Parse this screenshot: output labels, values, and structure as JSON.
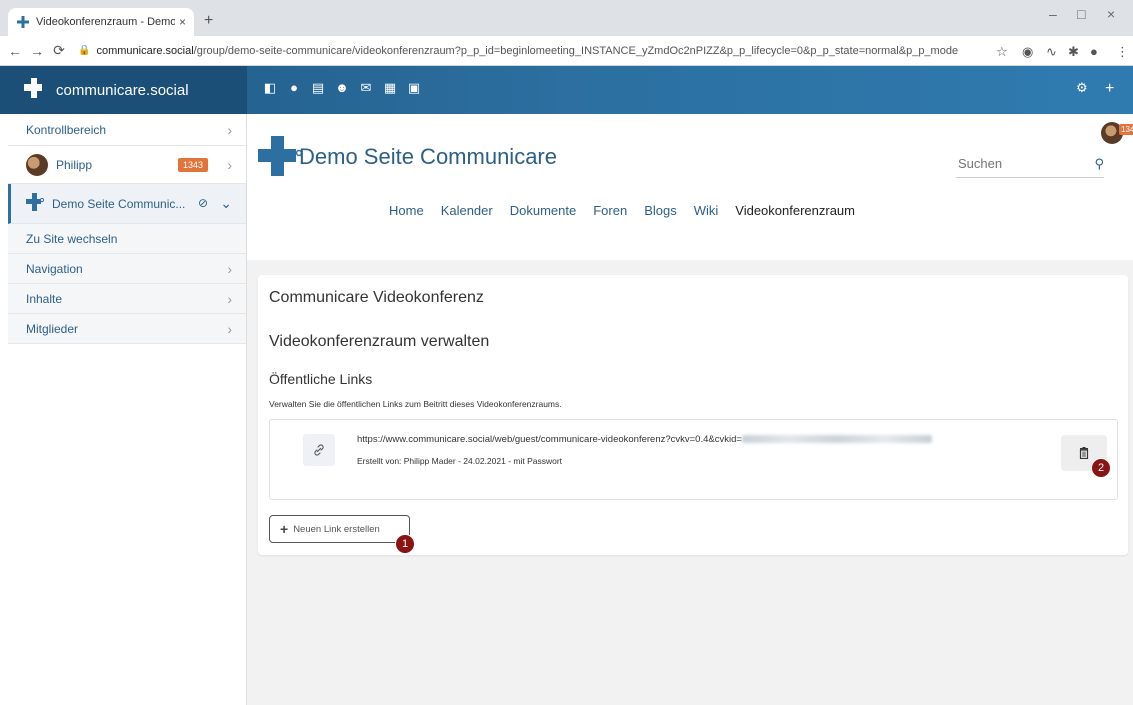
{
  "browser": {
    "tab_title": "Videokonferenzraum - Demo Sei",
    "tab_close": "×",
    "new_tab": "+",
    "win_min": "–",
    "win_max": "□",
    "win_close": "×",
    "url_host": "communicare.social",
    "url_path": "/group/demo-seite-communicare/videokonferenzraum?p_p_id=beginlomeeting_INSTANCE_yZmdOc2nPIZZ&p_p_lifecycle=0&p_p_state=normal&p_p_mode=view&_be..."
  },
  "app": {
    "brand": "communicare.social"
  },
  "sidebar": {
    "control_panel": "Kontrollbereich",
    "user_name": "Philipp",
    "user_badge": "1343",
    "site_name": "Demo Seite Communic...",
    "sub_items": [
      {
        "label": "Zu Site wechseln"
      },
      {
        "label": "Navigation"
      },
      {
        "label": "Inhalte"
      },
      {
        "label": "Mitglieder"
      }
    ]
  },
  "site": {
    "name": "Demo Seite Communicare",
    "search_placeholder": "Suchen",
    "top_badge": "134",
    "nav": [
      {
        "label": "Home"
      },
      {
        "label": "Kalender"
      },
      {
        "label": "Dokumente"
      },
      {
        "label": "Foren"
      },
      {
        "label": "Blogs"
      },
      {
        "label": "Wiki"
      },
      {
        "label": "Videokonferenzraum"
      }
    ]
  },
  "content": {
    "portlet_title": "Communicare Videokonferenz",
    "manage_title": "Videokonferenzraum verwalten",
    "public_links_title": "Öffentliche Links",
    "description": "Verwalten Sie die öffentlichen Links zum Beitritt dieses Videokonferenzraums.",
    "link_url_prefix": "https://www.communicare.social/web/guest/communicare-videokonferenz?cvkv=0.4&cvkid=",
    "link_meta": "Erstellt von: Philipp Mader - 24.02.2021 - mit Passwort",
    "new_link_label": "Neuen Link erstellen",
    "marker_1": "1",
    "marker_2": "2"
  },
  "colors": {
    "accent": "#2c6fa0",
    "brand_dark": "#1b4f78",
    "badge": "#e0743a",
    "marker": "#8a1313"
  }
}
